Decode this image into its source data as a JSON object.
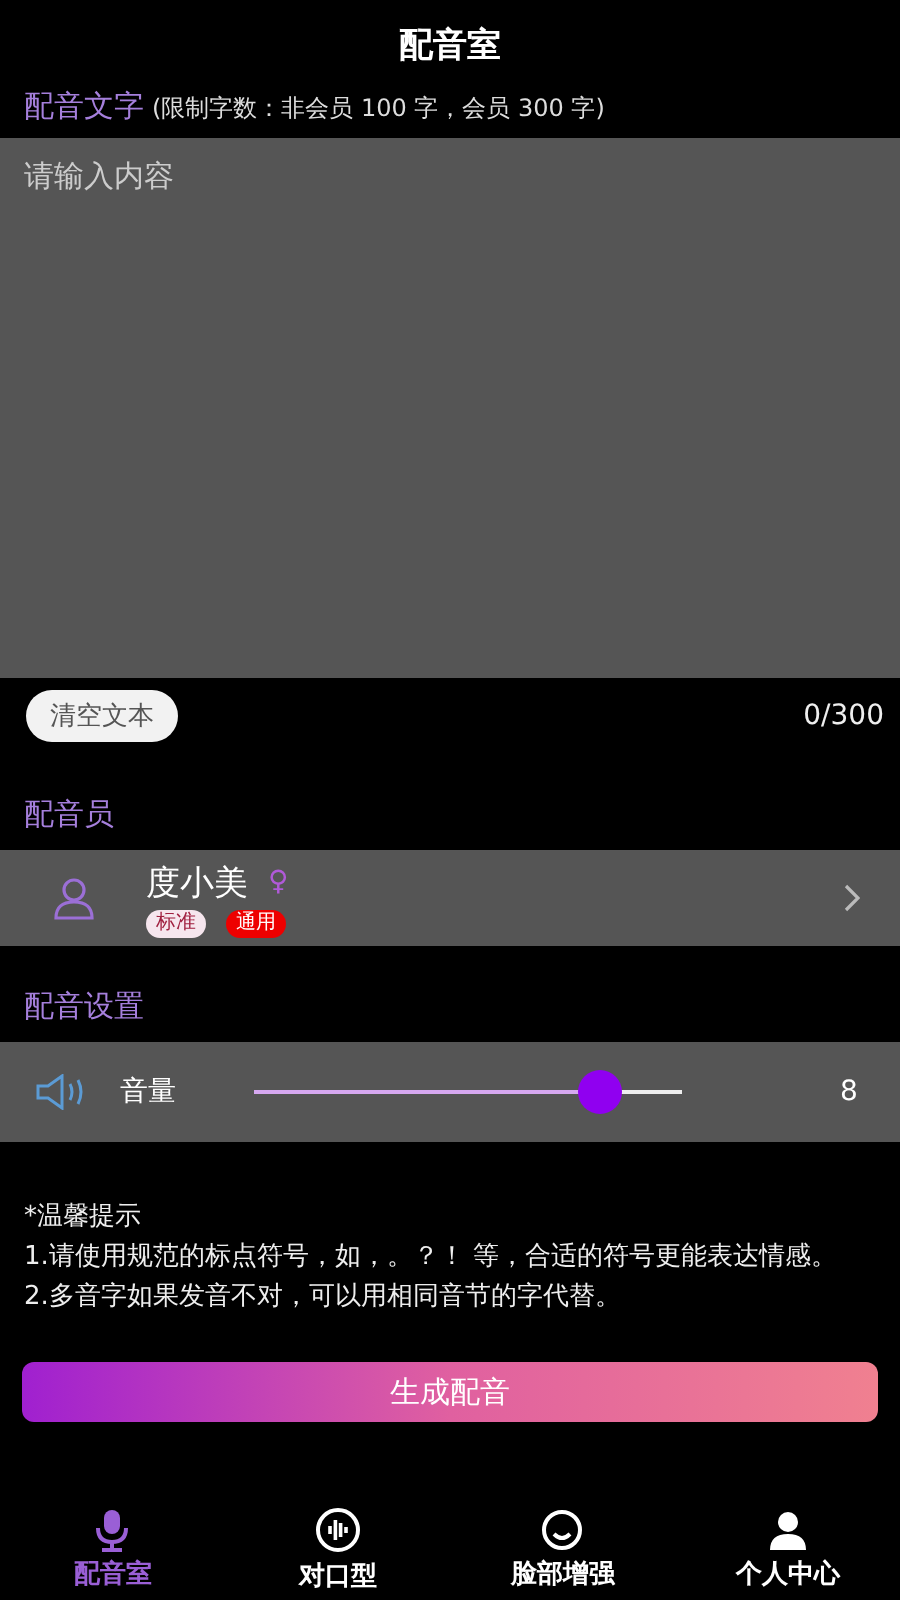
{
  "header": {
    "title": "配音室"
  },
  "text_section": {
    "label": "配音文字",
    "hint": "(限制字数：非会员 100 字，会员 300 字)",
    "placeholder": "请输入内容",
    "clear_button": "清空文本",
    "counter": "0/300"
  },
  "voice_section": {
    "label": "配音员",
    "voice": {
      "name": "度小美",
      "gender_symbol": "♀",
      "tags": [
        {
          "label": "标准",
          "kind": "light"
        },
        {
          "label": "通用",
          "kind": "red"
        }
      ]
    }
  },
  "settings_section": {
    "label": "配音设置",
    "volume": {
      "label": "音量",
      "level": 0.81,
      "reading": "8"
    }
  },
  "tips": [
    "*温馨提示",
    "1.请使用规范的标点符号，如，。？！ 等，合适的符号更能表达情感。",
    "2.多音字如果发音不对，可以用相同音节的字代替。"
  ],
  "generate_button": "生成配音",
  "tabs": [
    {
      "label": "配音室",
      "kind": "mic",
      "selected": true
    },
    {
      "label": "对口型",
      "kind": "wave",
      "selected": false
    },
    {
      "label": "脸部增强",
      "kind": "face",
      "selected": false
    },
    {
      "label": "个人中心",
      "kind": "person",
      "selected": false
    }
  ]
}
